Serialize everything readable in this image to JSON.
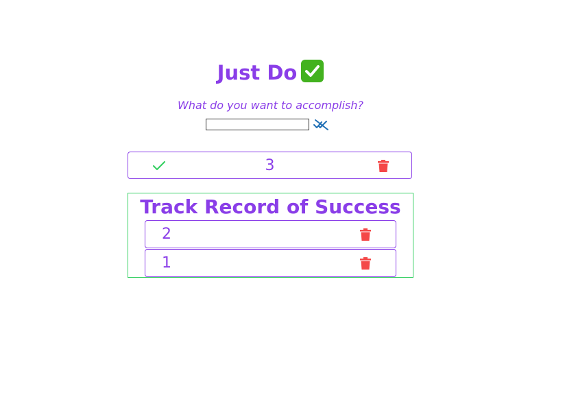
{
  "header": {
    "title": "Just Do",
    "emoji_icon": "check-mark-button-emoji"
  },
  "form": {
    "prompt": "What do you want to accomplish?",
    "input_value": "",
    "clear_icon": "double-check-slash-icon"
  },
  "current_task": {
    "text": "3",
    "complete_icon": "check-icon",
    "delete_icon": "trash-icon"
  },
  "track_record": {
    "title": "Track Record of Success",
    "items": [
      {
        "text": "2",
        "delete_icon": "trash-icon"
      },
      {
        "text": "1",
        "delete_icon": "trash-icon"
      }
    ]
  },
  "colors": {
    "accent": "#8a3ee8",
    "success_border": "#3ad166",
    "check": "#3ad166",
    "delete": "#f44848",
    "clear_icon": "#1f6fb5"
  }
}
